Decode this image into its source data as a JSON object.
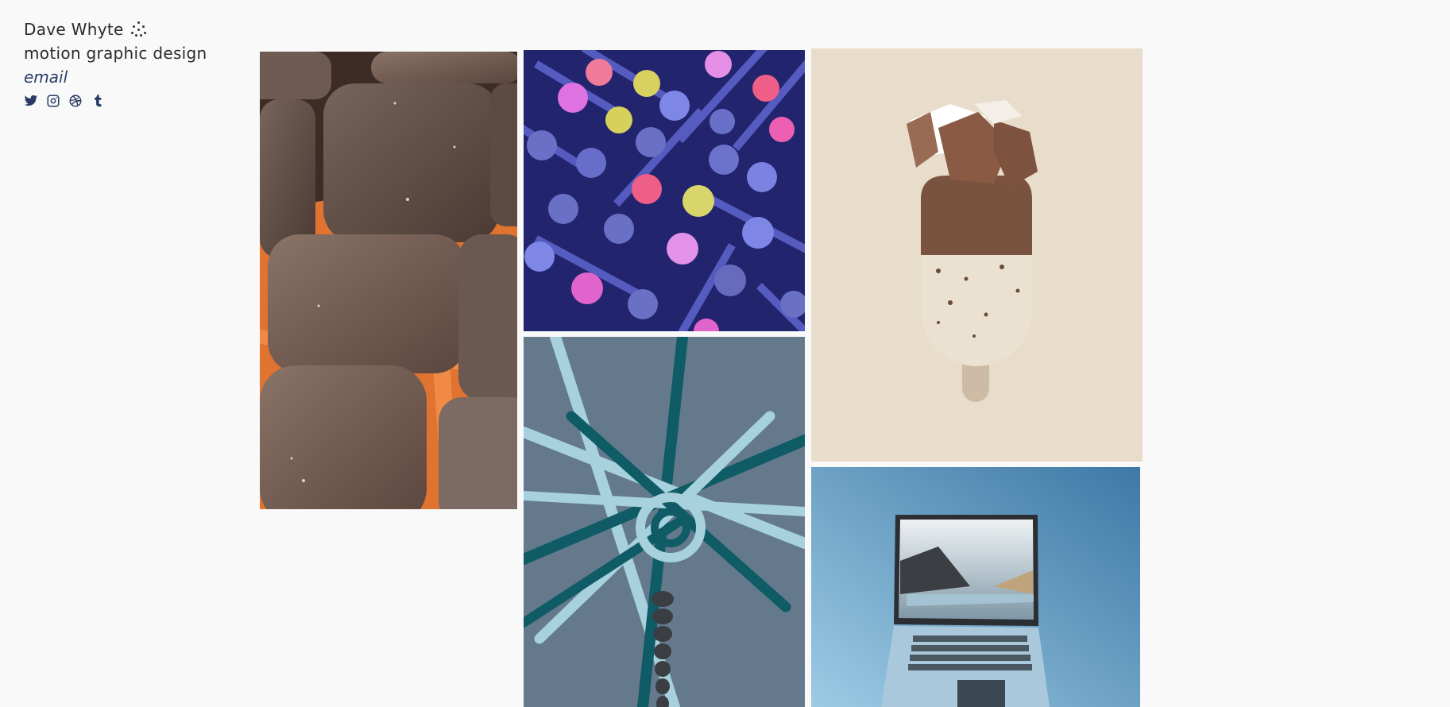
{
  "header": {
    "name": "Dave Whyte",
    "subtitle": "motion graphic design",
    "email_label": "email"
  },
  "socials": [
    {
      "name": "twitter-icon"
    },
    {
      "name": "instagram-icon"
    },
    {
      "name": "dribbble-icon"
    },
    {
      "name": "tumblr-icon"
    }
  ],
  "colors": {
    "background": "#f9f9f9",
    "text": "#2b2b2b",
    "link": "#2a3c66",
    "chocolate": "#6f5b50",
    "tray_orange": "#e0742f",
    "maze_navy": "#1d1f66",
    "rope_bg": "#647a8c",
    "rope_teal": "#0f5b66",
    "icecream_bg": "#e8dccb",
    "laptop_blue": "#7fb1d3"
  },
  "gallery": [
    {
      "name": "chocolate-squares-tile"
    },
    {
      "name": "maze-cylinders-tile"
    },
    {
      "name": "chocolate-icecream-tile"
    },
    {
      "name": "rope-knot-tile"
    },
    {
      "name": "laptop-tile"
    }
  ]
}
